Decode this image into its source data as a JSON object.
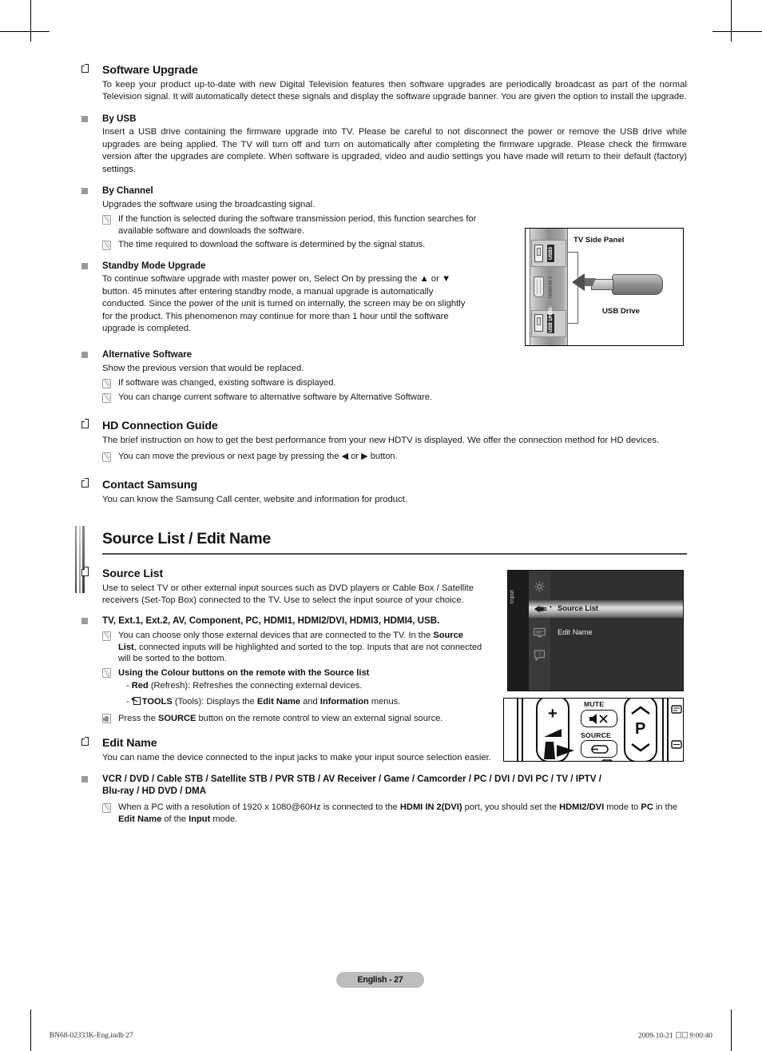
{
  "document": {
    "page_label": "English - 27",
    "print_left": "BN68-02333K-Eng.indb   27",
    "print_date": "2009-10-21",
    "print_time": "9:00:40"
  },
  "software_upgrade": {
    "title": "Software Upgrade",
    "intro": "To keep your product up-to-date with new Digital Television features then software upgrades are periodically broadcast as part of the normal Television signal. It will automatically detect these signals and display the software upgrade banner. You are given the option to install the upgrade.",
    "by_usb": {
      "title": "By USB",
      "text": "Insert a USB drive containing the firmware upgrade into TV. Please be careful to not disconnect the power or remove the USB drive while upgrades are being applied. The TV will turn off and turn on automatically after completing the firmware upgrade. Please check the firmware version after the upgrades are complete. When software is upgraded, video and audio settings you have made will return to their default (factory) settings."
    },
    "by_channel": {
      "title": "By Channel",
      "text": "Upgrades the software using the broadcasting signal.",
      "notes": [
        "If the function is selected during the software transmission period, this function searches for available software and downloads the software.",
        "The time required to download the software is determined by the signal status."
      ]
    },
    "standby": {
      "title": "Standby Mode Upgrade",
      "text": "To continue software upgrade with master power on, Select On by pressing the ▲ or ▼ button. 45 minutes after entering standby mode, a manual upgrade is automatically conducted. Since the power of the unit is turned on internally, the screen may be on slightly for the product. This phenomenon may continue for more than 1 hour until the software upgrade is completed."
    },
    "alternative": {
      "title": "Alternative Software",
      "text": "Show the previous version that would be replaced.",
      "notes": [
        "If software was changed, existing software is displayed.",
        "You can change current software to alternative software by Alternative Software."
      ]
    }
  },
  "hd_connection_guide": {
    "title": "HD Connection Guide",
    "text": "The brief instruction on how to get the best performance from your new HDTV is displayed. We offer the connection method for HD devices.",
    "note": "You can move the previous or next page by pressing the ◀ or ▶ button."
  },
  "contact_samsung": {
    "title": "Contact Samsung",
    "text": "You can know the Samsung Call center, website and information for product."
  },
  "tv_figure": {
    "caption": "TV Side Panel",
    "usb_drive_label": "USB Drive",
    "ports": [
      {
        "label": "USB3",
        "type": "usb"
      },
      {
        "label": "HDMI IN 4",
        "type": "hdmi"
      },
      {
        "label": "USB 1/HDD",
        "type": "usb"
      }
    ]
  },
  "section": {
    "title": "Source List / Edit Name"
  },
  "source_list": {
    "title": "Source List",
    "text": "Use to select TV or other external input sources such as DVD players or Cable Box / Satellite receivers (Set-Top Box) connected to the TV. Use to select the input source of your choice.",
    "inputs_title": "TV, Ext.1, Ext.2, AV, Component, PC, HDMI1, HDMI2/DVI, HDMI3, HDMI4, USB.",
    "note_connected_a": "You can choose only those external devices that are connected to the TV. In the ",
    "note_connected_b": "Source List",
    "note_connected_c": ", connected inputs will be highlighted and sorted to the top. Inputs that are not connected will be sorted to the bottom.",
    "colour_title": "Using the Colour buttons on the remote with the Source list",
    "red_key": "Red",
    "red_text": " (Refresh): Refreshes the connecting external devices.",
    "tools_key": "TOOLS",
    "tools_text_a": " (Tools): Displays the ",
    "tools_text_b": "Edit Name",
    "tools_text_c": " and ",
    "tools_text_d": "Information",
    "tools_text_e": " menus.",
    "press_a": "Press the ",
    "press_b": "SOURCE",
    "press_c": " button on the remote control to view an external signal source."
  },
  "osd_figure": {
    "rail_label": "Input",
    "rows": [
      {
        "label": "Source List",
        "selected": true
      },
      {
        "label": "Edit Name",
        "selected": false
      }
    ],
    "icons": [
      "gear-icon",
      "input-plug-icon",
      "monitor-icon",
      "support-icon"
    ]
  },
  "remote_figure": {
    "mute_label": "MUTE",
    "source_label": "SOURCE",
    "channel_label": "P",
    "volume_plus": "+",
    "volume_minus": "–"
  },
  "edit_name": {
    "title": "Edit Name",
    "text": "You can name the device connected to the input jacks to make your input source selection easier.",
    "devices_line1": "VCR / DVD / Cable STB / Satellite STB / PVR STB / AV Receiver / Game / Camcorder / PC / DVI / DVI PC / TV / IPTV /",
    "devices_line2": "Blu-ray / HD DVD / DMA",
    "note_a": "When a PC with a resolution of 1920 x 1080@60Hz is connected to the ",
    "note_b": "HDMI IN 2(DVI)",
    "note_c": "  port, you should set the ",
    "note_d": "HDMI2/DVI",
    "note_e": " mode to ",
    "note_f": "PC",
    "note_g": " in the ",
    "note_h": "Edit Name",
    "note_i": " of the ",
    "note_j": "Input",
    "note_k": " mode."
  }
}
